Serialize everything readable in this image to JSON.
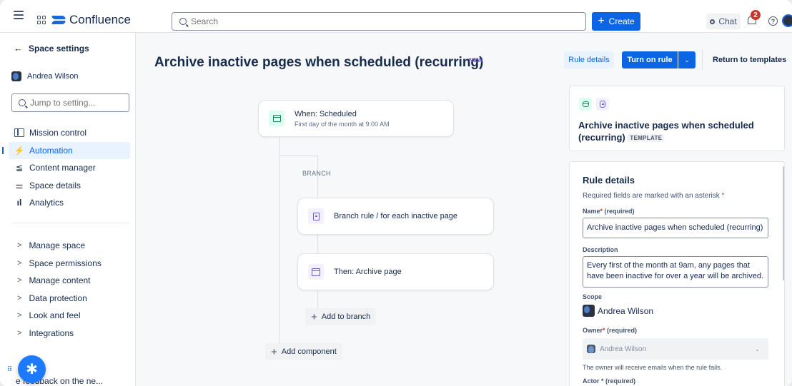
{
  "topbar": {
    "app_name": "Confluence",
    "search_placeholder": "Search",
    "create_label": "Create",
    "chat_label": "Chat",
    "notifications_count": "2",
    "help_glyph": "?"
  },
  "sidebar": {
    "back_label": "Space settings",
    "user_name": "Andrea Wilson",
    "jump_placeholder": "Jump to setting...",
    "nav_items": [
      {
        "label": "Mission control",
        "icon": "mission-control-icon"
      },
      {
        "label": "Automation",
        "icon": "lightning-icon",
        "active": true
      },
      {
        "label": "Content manager",
        "icon": "content-manager-icon"
      },
      {
        "label": "Space details",
        "icon": "sliders-icon"
      },
      {
        "label": "Analytics",
        "icon": "bar-chart-icon"
      }
    ],
    "groups": [
      {
        "label": "Manage space"
      },
      {
        "label": "Space permissions"
      },
      {
        "label": "Manage content"
      },
      {
        "label": "Data protection"
      },
      {
        "label": "Look and feel"
      },
      {
        "label": "Integrations"
      }
    ],
    "feedback_label": "e feedback on the ne..."
  },
  "main": {
    "title": "Archive inactive pages when scheduled (recurring)",
    "new_lozenge": "NEW",
    "rule_details_btn": "Rule details",
    "turn_on_btn": "Turn on rule",
    "return_link": "Return to templates"
  },
  "flow": {
    "trigger_title": "When: Scheduled",
    "trigger_sub": "First day of the month at 9:00 AM",
    "branch_label": "BRANCH",
    "branch_node": "Branch rule / for each inactive page",
    "action_node": "Then: Archive page",
    "add_to_branch": "Add to branch",
    "add_component": "Add component"
  },
  "summary": {
    "title": "Archive inactive pages when scheduled (recurring)",
    "lozenge": "TEMPLATE"
  },
  "details": {
    "heading": "Rule details",
    "required_note": "Required fields are marked with an asterisk",
    "asterisk": "*",
    "name_label": "Name",
    "name_req": "(required)",
    "name_value": "Archive inactive pages when scheduled (recurring)",
    "description_label": "Description",
    "description_value": "Every first of the month at 9am, any pages that have been inactive for over a year will be archived.",
    "scope_label": "Scope",
    "scope_value": "Andrea Wilson",
    "owner_label": "Owner",
    "owner_req": "(required)",
    "owner_value": "Andrea Wilson",
    "owner_help": "The owner will receive emails when the rule fails.",
    "next_label_cut": "Actor * (required)"
  },
  "colors": {
    "brand": "#1868db",
    "primary_button": "#0c66e4",
    "active_nav_bg": "#e9f2ff",
    "required_star": "#c9372c",
    "new_lozenge": "#6e5dc6",
    "trigger_icon": "#1f845a"
  }
}
